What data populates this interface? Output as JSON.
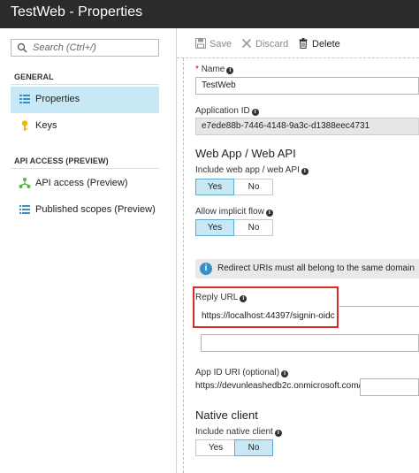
{
  "window": {
    "title": "TestWeb - Properties"
  },
  "search": {
    "placeholder": "Search (Ctrl+/)"
  },
  "sidebar": {
    "general_heading": "GENERAL",
    "api_heading": "API ACCESS (PREVIEW)",
    "general_items": [
      {
        "label": "Properties",
        "icon": "properties-icon"
      },
      {
        "label": "Keys",
        "icon": "key-icon"
      }
    ],
    "api_items": [
      {
        "label": "API access (Preview)",
        "icon": "api-access-icon"
      },
      {
        "label": "Published scopes (Preview)",
        "icon": "scopes-list-icon"
      }
    ]
  },
  "toolbar": {
    "save_label": "Save",
    "discard_label": "Discard",
    "delete_label": "Delete"
  },
  "form": {
    "name_label": "Name",
    "name_value": "TestWeb",
    "app_id_label": "Application ID",
    "app_id_value": "e7ede88b-7446-4148-9a3c-d1388eec4731",
    "webapp_heading": "Web App / Web API",
    "include_webapp_label": "Include web app / web API",
    "implicit_flow_label": "Allow implicit flow",
    "yes_label": "Yes",
    "no_label": "No",
    "redirect_notice": "Redirect URIs must all belong to the same domain",
    "reply_url_label": "Reply URL",
    "reply_url_value": "https://localhost:44397/signin-oidc",
    "app_id_uri_label": "App ID URI (optional)",
    "app_id_uri_prefix": "https://devunleashedb2c.onmicrosoft.com/",
    "native_heading": "Native client",
    "include_native_label": "Include native client"
  },
  "colors": {
    "accent_selected": "#c7e8f4",
    "highlight_border": "#d22c2c",
    "titlebar": "#2b2b2b"
  }
}
